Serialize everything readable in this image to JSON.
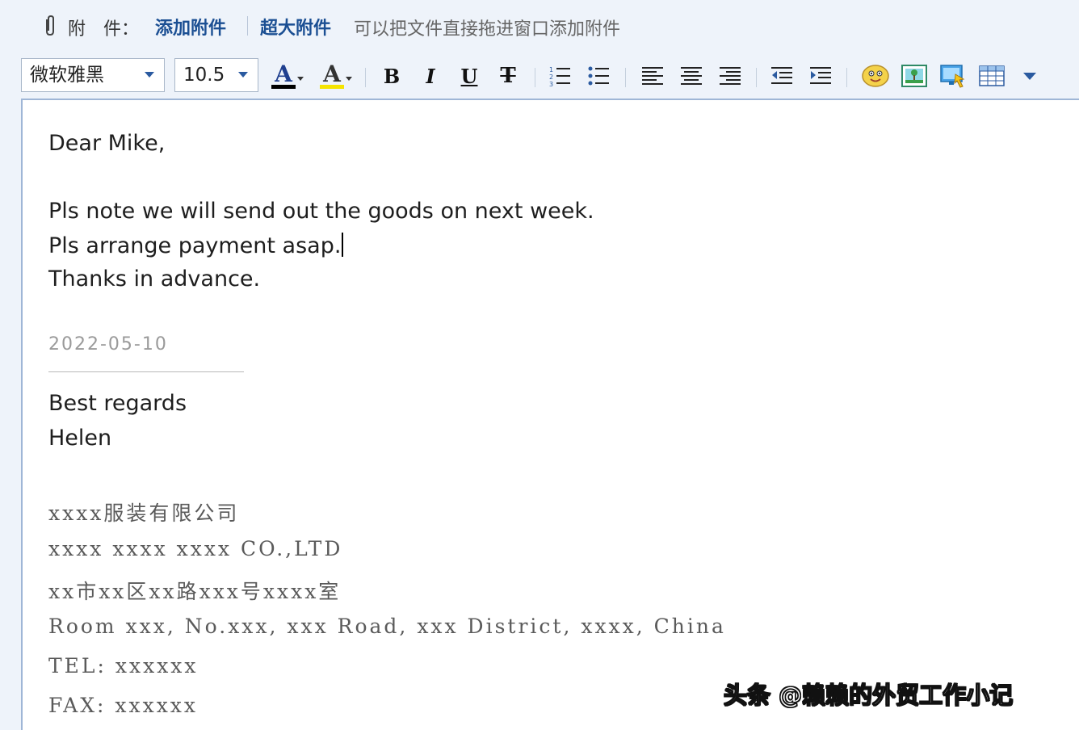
{
  "attachments": {
    "label": "附　件：",
    "add_attachment": "添加附件",
    "large_attachment": "超大附件",
    "hint": "可以把文件直接拖进窗口添加附件"
  },
  "toolbar": {
    "font_family": "微软雅黑",
    "font_size": "10.5",
    "font_color_glyph": "A",
    "highlight_glyph": "A",
    "bold": "B",
    "italic": "I",
    "underline": "U",
    "strike": "T"
  },
  "email": {
    "greeting": "Dear Mike,",
    "line1": "Pls note we will send out the goods on next week.",
    "line2": "Pls arrange payment asap.",
    "line3": "Thanks in advance.",
    "date": "2022-05-10",
    "closing": "Best regards",
    "name": "Helen"
  },
  "signature": {
    "company_cn": "xxxx服装有限公司",
    "company_en": "xxxx xxxx xxxx CO.,LTD",
    "address_cn": "xx市xx区xx路xxx号xxxx室",
    "address_en": "Room xxx, No.xxx, xxx Road, xxx District, xxxx, China",
    "tel": "TEL: xxxxxx",
    "fax": "FAX: xxxxxx"
  },
  "watermark": "头条 @赖赖的外贸工作小记",
  "colors": {
    "link": "#1b4f93",
    "toolbar_bg": "#eef3fa",
    "editor_border": "#9fb6d6"
  }
}
